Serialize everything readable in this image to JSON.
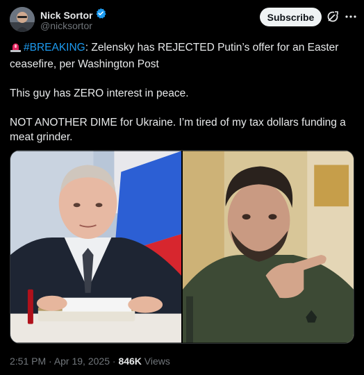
{
  "author": {
    "name": "Nick Sortor",
    "handle": "@nicksortor",
    "verified": true,
    "verified_color": "#1d9bf0"
  },
  "actions": {
    "subscribe_label": "Subscribe",
    "grok_icon": "grok-icon",
    "more_icon": "more-icon"
  },
  "post": {
    "siren_emoji": "🚨",
    "hashtag": "#BREAKING",
    "line1_rest": ": Zelensky has REJECTED Putin’s offer for an Easter ceasefire, per Washington Post",
    "line2": "This guy has ZERO interest in peace.",
    "line3": "NOT ANOTHER DIME for Ukraine. I’m tired of my tax dollars funding a meat grinder."
  },
  "media": {
    "left_photo": "putin-photo",
    "right_photo": "zelensky-photo"
  },
  "meta": {
    "time": "2:51 PM",
    "sep1": " · ",
    "date": "Apr 19, 2025",
    "sep2": " · ",
    "views_count": "846K",
    "views_label": " Views"
  },
  "colors": {
    "background": "#000000",
    "text": "#e7e9ea",
    "muted": "#71767b",
    "link": "#1d9bf0"
  }
}
